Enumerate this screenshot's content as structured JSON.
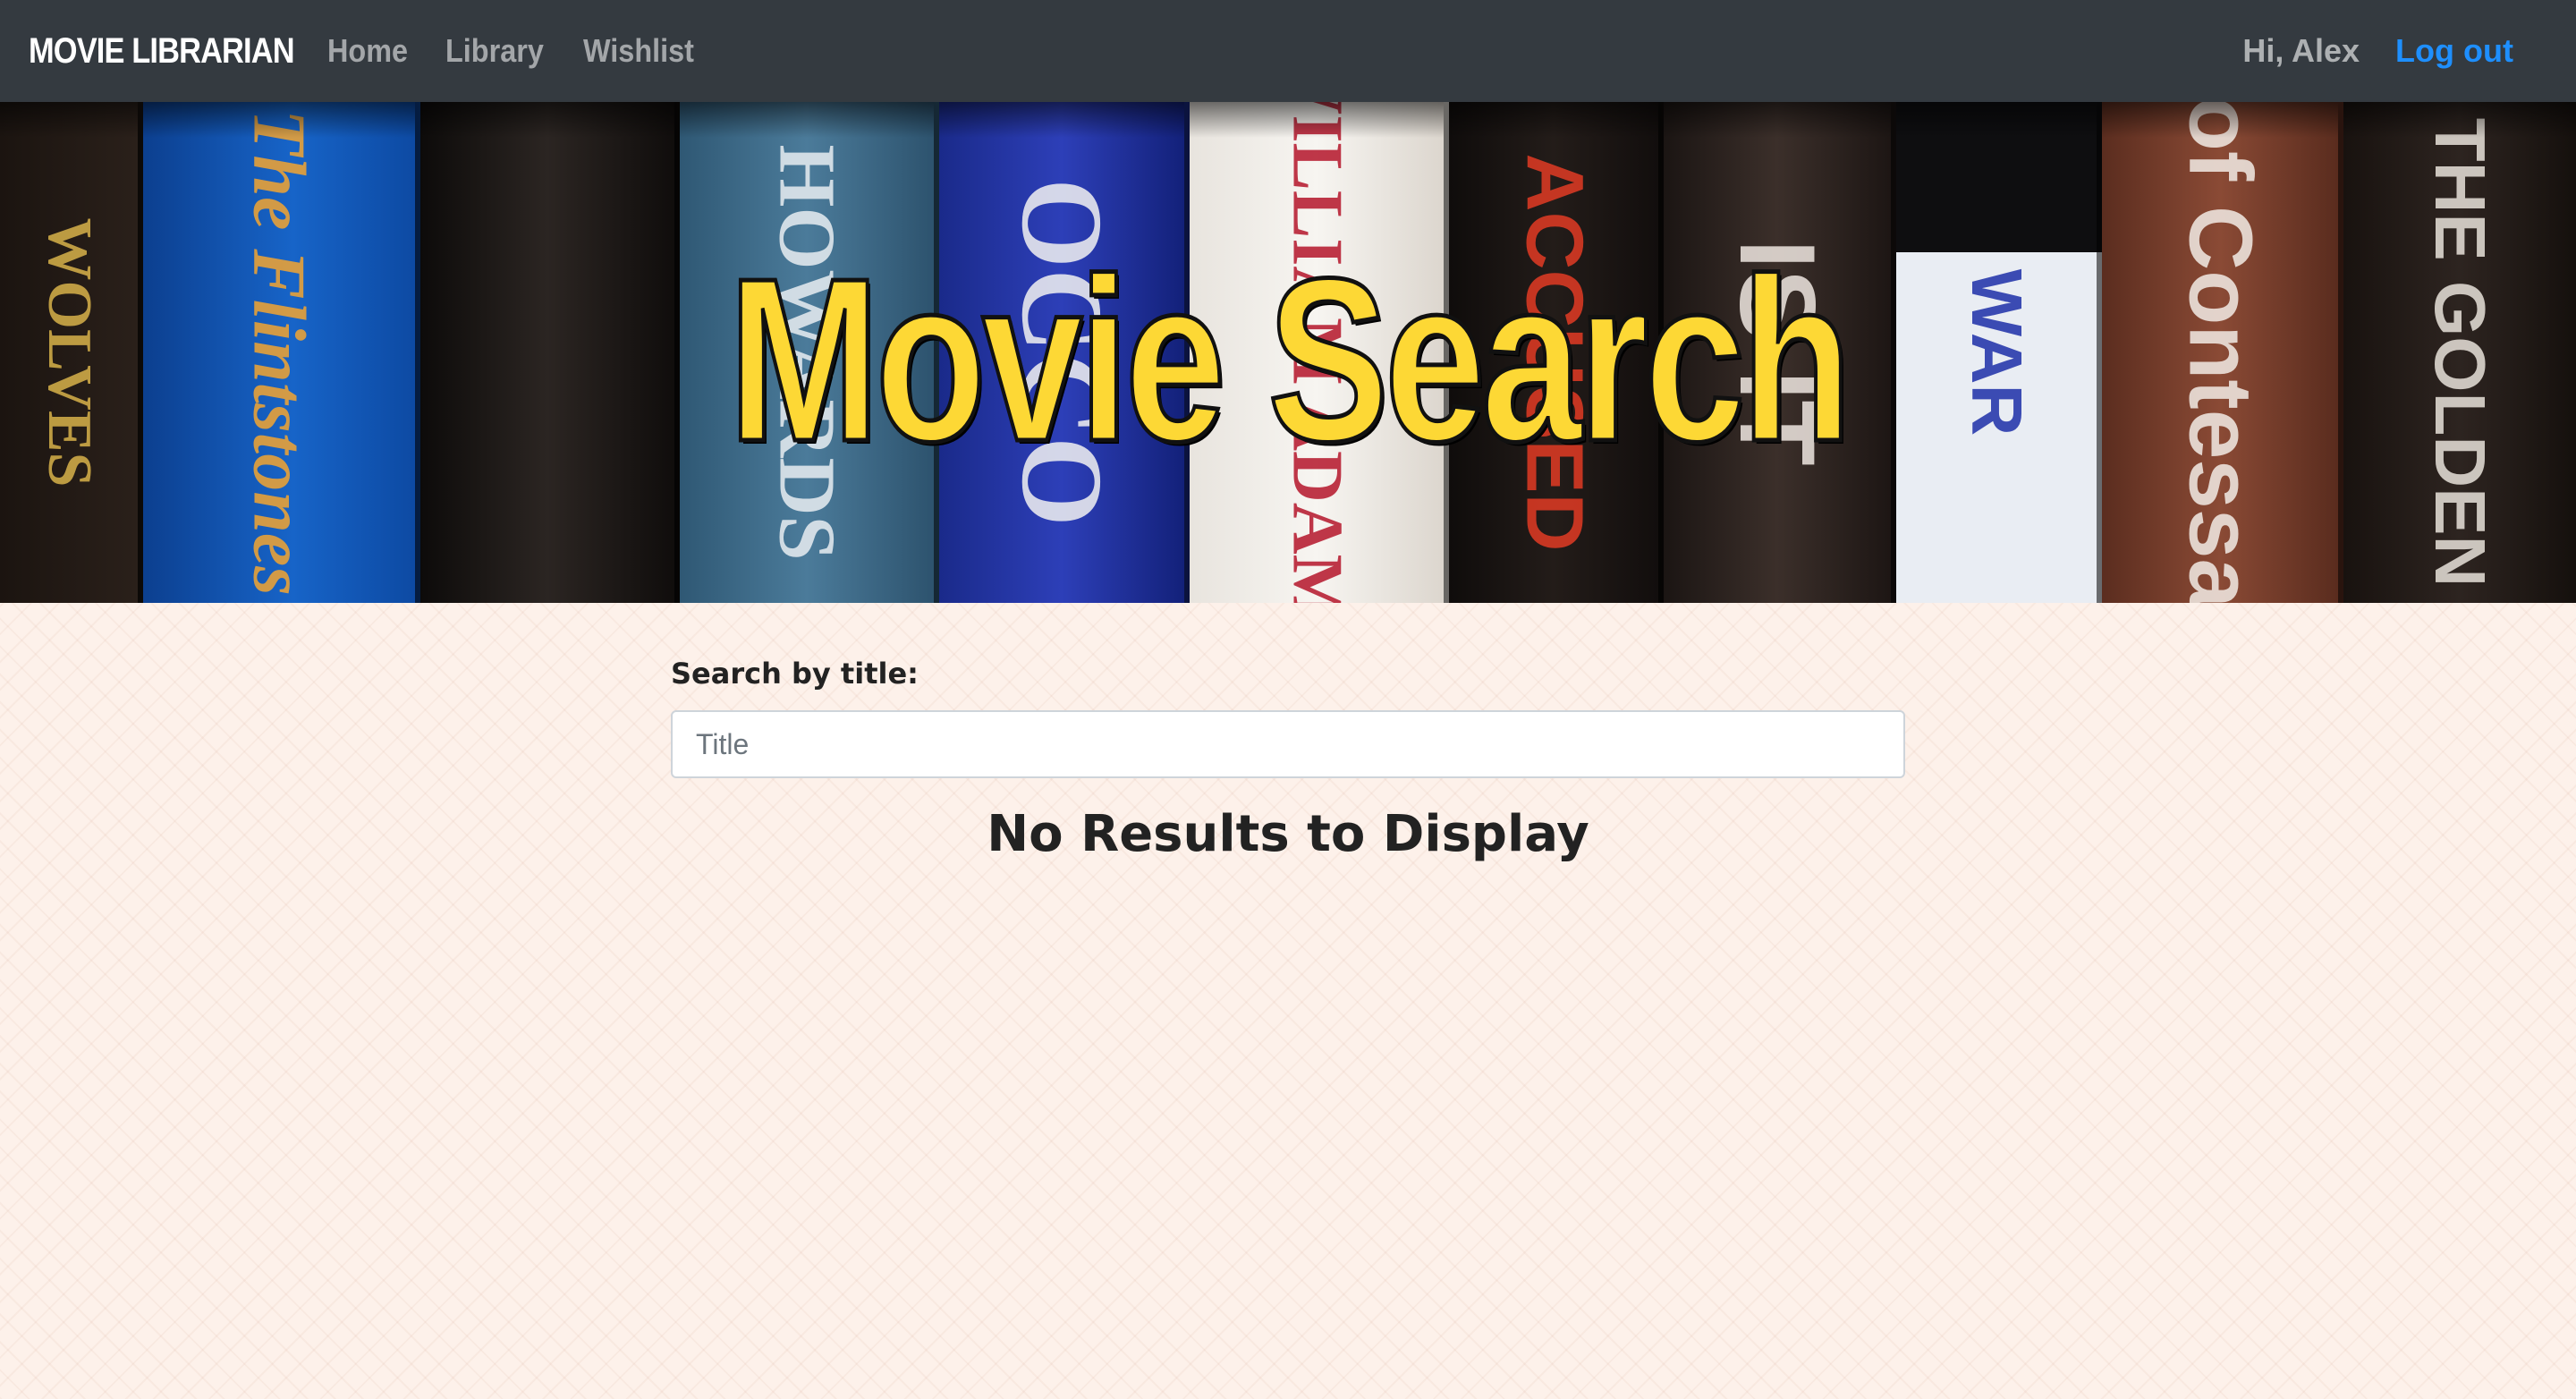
{
  "nav": {
    "brand": "MOVIE LIBRARIAN",
    "links": [
      "Home",
      "Library",
      "Wishlist"
    ],
    "greeting": "Hi, Alex",
    "logout": "Log out"
  },
  "hero": {
    "title": "Movie Search",
    "spines": [
      "WOLVES",
      "The Flintstones",
      "",
      "HOWARDS",
      "OCCO",
      "WILLIAM ADAMS",
      "ACCUSED",
      "IS IT",
      "WAR",
      "of Contessa",
      "THE GOLDEN"
    ]
  },
  "search": {
    "label": "Search by title:",
    "placeholder": "Title",
    "value": ""
  },
  "results": {
    "empty_message": "No Results to Display"
  },
  "colors": {
    "navbar": "#343a40",
    "accent_link": "#1e8fff",
    "hero_title": "#fdd835",
    "page_bg": "#fdf1ea"
  }
}
